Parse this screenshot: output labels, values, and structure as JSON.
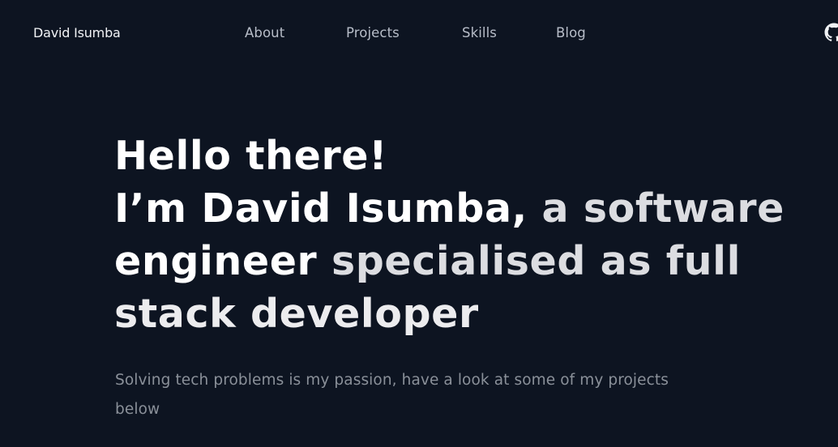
{
  "header": {
    "brand": "David Isumba",
    "nav": [
      {
        "label": "About"
      },
      {
        "label": "Projects"
      },
      {
        "label": "Skills"
      },
      {
        "label": "Blog"
      }
    ],
    "github_icon": "github-icon"
  },
  "hero": {
    "line1": "Hello there!",
    "line2_a": "I’m David Isumba,",
    "line2_b": " a software",
    "line3_a": "engineer",
    "line3_b": " specialised as full",
    "line4_a": "stack developer",
    "subtitle": "Solving tech problems is my passion, have a look at some of my projects below"
  },
  "colors": {
    "background": "#0d1421",
    "heading": "#ffffff",
    "nav_text": "#b7bdc8",
    "subtitle_text": "#8a9099"
  }
}
